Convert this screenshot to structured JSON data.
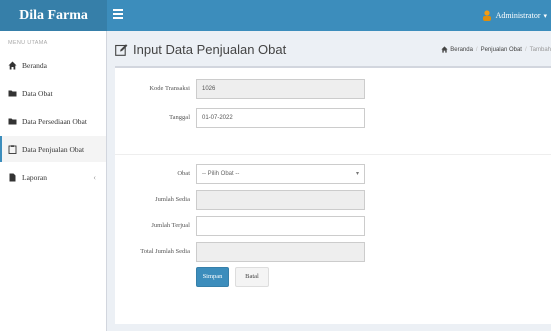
{
  "header": {
    "brand": "Dila Farma",
    "user": "Administrator"
  },
  "sidebar": {
    "menu_header": "MENU UTAMA",
    "items": [
      {
        "label": "Beranda",
        "icon": "home-icon"
      },
      {
        "label": "Data Obat",
        "icon": "folder-icon"
      },
      {
        "label": "Data Persediaan Obat",
        "icon": "folder-icon"
      },
      {
        "label": "Data Penjualan Obat",
        "icon": "clipboard-icon",
        "active": true
      },
      {
        "label": "Laporan",
        "icon": "file-icon",
        "has_submenu": true
      }
    ]
  },
  "page": {
    "title": "Input Data Penjualan Obat",
    "breadcrumb": [
      "Beranda",
      "Penjualan Obat",
      "Tambah"
    ]
  },
  "form": {
    "kode_label": "Kode Transaksi",
    "kode_value": "1026",
    "tanggal_label": "Tanggal",
    "tanggal_value": "01-07-2022",
    "obat_label": "Obat",
    "obat_value": "-- Pilih Obat --",
    "stok_label": "Jumlah Sedia",
    "stok_value": "",
    "jual_label": "Jumlah Terjual",
    "jual_value": "",
    "total_label": "Total Jumlah Sedia",
    "total_value": "",
    "save_label": "Simpan",
    "cancel_label": "Batal"
  },
  "colors": {
    "topbar": "#3c8dbc",
    "brand_bg": "#367fa9",
    "primary": "#3c8dbc",
    "user_icon": "#f39c12"
  }
}
